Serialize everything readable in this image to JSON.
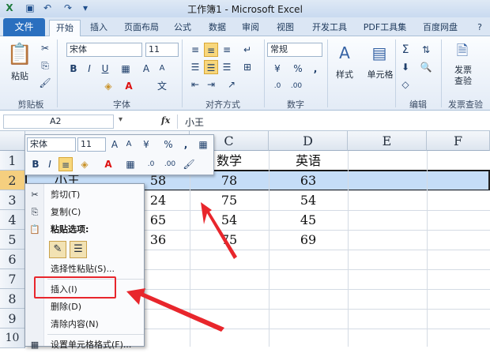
{
  "window": {
    "title": "工作簿1 - Microsoft Excel"
  },
  "tabs": [
    "文件",
    "开始",
    "插入",
    "页面布局",
    "公式",
    "数据",
    "审阅",
    "视图",
    "开发工具",
    "PDF工具集",
    "百度网盘"
  ],
  "ribbon": {
    "font_name": "宋体",
    "font_size": "11",
    "number_format": "常规",
    "paste_label": "粘贴",
    "styles_label": "样式",
    "cells_label": "单元格",
    "invoice_label": "发票\n查验",
    "groups": [
      "剪贴板",
      "字体",
      "对齐方式",
      "数字",
      "编辑",
      "发票查验"
    ]
  },
  "formula_bar": {
    "name_box": "A2",
    "fx": "fx",
    "value": "小王"
  },
  "grid": {
    "columns": [
      "C",
      "D",
      "E",
      "F"
    ],
    "rows": [
      "1",
      "2",
      "3",
      "4",
      "5",
      "6",
      "7",
      "8",
      "9",
      "10"
    ],
    "header_row": {
      "c": "数学",
      "d": "英语"
    },
    "a2": "小王",
    "b_values": [
      "58",
      "24",
      "65",
      "36"
    ],
    "c_values": [
      "78",
      "75",
      "54",
      "75"
    ],
    "d_values": [
      "63",
      "54",
      "45",
      "69"
    ]
  },
  "mini_toolbar": {
    "font": "宋体",
    "size": "11",
    "percent": "%",
    "comma": ","
  },
  "context_menu": {
    "cut": "剪切(T)",
    "copy": "复制(C)",
    "paste_options": "粘贴选项:",
    "paste_special": "选择性粘贴(S)...",
    "insert": "插入(I)",
    "delete": "删除(D)",
    "clear": "清除内容(N)",
    "format_cells": "设置单元格格式(F)..."
  },
  "colors": {
    "annotation": "#e8262c",
    "selection": "#c5ddf7",
    "file_tab": "#2a6fbf"
  }
}
